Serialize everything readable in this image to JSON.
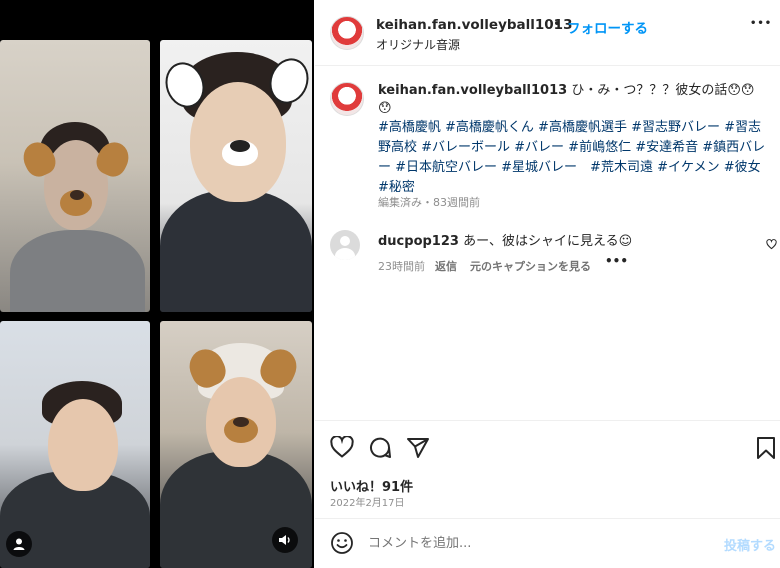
{
  "header": {
    "username": "keihan.fan.volleyball1013",
    "separator": "•",
    "follow_label": "フォローする",
    "audio": "オリジナル音源",
    "more": "•••"
  },
  "caption": {
    "username": "keihan.fan.volleyball1013",
    "text": "ひ・み・つ？？？彼女の話😯😯😯",
    "hashtags": "#高橋慶帆 #高橋慶帆くん #高橋慶帆選手 #習志野バレー #習志野高校 #バレーボール #バレー #前嶋悠仁 #安達希音 #鎮西バレー #日本航空バレー #星城バレー　#荒木司遠 #イケメン #彼女 #秘密",
    "meta": "編集済み・83週間前"
  },
  "comment": {
    "username": "ducpop123",
    "text": "あー、彼はシャイに見える☺",
    "time": "23時間前",
    "reply": "返信",
    "see_original": "元のキャプションを見る",
    "more": "•••"
  },
  "actions": {
    "likes": "いいね！91件",
    "date": "2022年2月17日"
  },
  "composer": {
    "placeholder": "コメントを追加...",
    "post_label": "投稿する"
  },
  "colors": {
    "link": "#0095f6",
    "hashtag": "#00376b",
    "muted": "#8e8e8e"
  }
}
